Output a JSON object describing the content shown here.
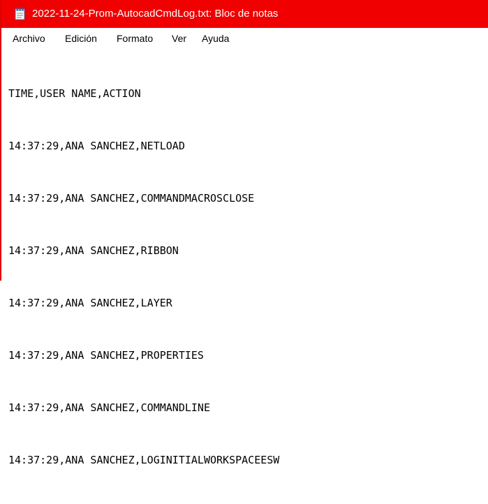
{
  "window": {
    "title": "2022-11-24-Prom-AutocadCmdLog.txt: Bloc de notas",
    "icon": "notepad-icon",
    "titlebar_color": "#f00000",
    "border_color": "#e00000"
  },
  "menu": {
    "items": [
      {
        "label": "Archivo"
      },
      {
        "label": "Edición"
      },
      {
        "label": "Formato"
      },
      {
        "label": "Ver"
      },
      {
        "label": "Ayuda"
      }
    ]
  },
  "document": {
    "lines": [
      "TIME,USER NAME,ACTION",
      "14:37:29,ANA SANCHEZ,NETLOAD",
      "14:37:29,ANA SANCHEZ,COMMANDMACROSCLOSE",
      "14:37:29,ANA SANCHEZ,RIBBON",
      "14:37:29,ANA SANCHEZ,LAYER",
      "14:37:29,ANA SANCHEZ,PROPERTIES",
      "14:37:29,ANA SANCHEZ,COMMANDLINE",
      "14:37:29,ANA SANCHEZ,LOGINITIALWORKSPACEESW"
    ]
  }
}
